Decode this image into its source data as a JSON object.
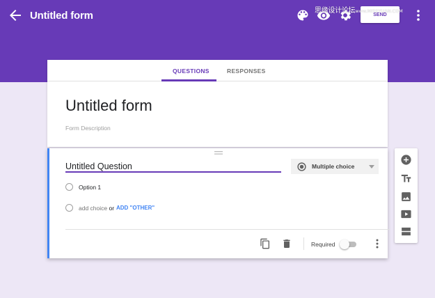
{
  "header": {
    "title": "Untitled form",
    "send_label": "SEND",
    "watermark_text": "思缘设计论坛",
    "watermark_site": "www.MISSYUAN.COM"
  },
  "icons": {
    "back": "arrow-left-icon",
    "palette": "palette-icon",
    "preview": "eye-icon",
    "settings": "gear-icon",
    "more": "more-vert-icon"
  },
  "tabs": [
    {
      "label": "QUESTIONS",
      "active": true
    },
    {
      "label": "RESPONSES",
      "active": false
    }
  ],
  "form": {
    "title": "Untitled form",
    "description_placeholder": "Form Description"
  },
  "question": {
    "title": "Untitled Question",
    "type": "Multiple choice",
    "options": [
      "Option 1"
    ],
    "add_choice_label": "add choice",
    "or_label": "or",
    "add_other_label": "ADD \"OTHER\"",
    "required_label": "Required",
    "required": false
  },
  "colors": {
    "primary": "#673ab7",
    "background": "#ede7f6",
    "accent_blue": "#4285f4"
  },
  "side_tools": [
    "add-question-icon",
    "add-title-icon",
    "add-image-icon",
    "add-video-icon",
    "add-section-icon"
  ]
}
